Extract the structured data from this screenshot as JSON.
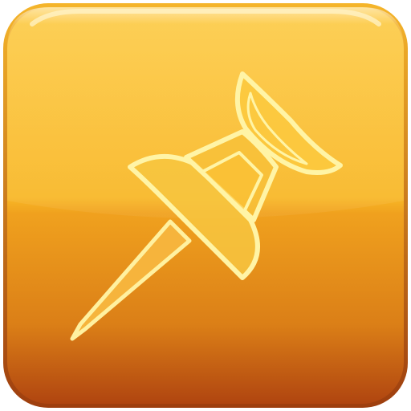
{
  "icon": {
    "name": "pushpin-icon",
    "colors": {
      "tile_top": "#FDC22F",
      "tile_mid": "#F1A01B",
      "tile_bottom": "#B14710",
      "border_outer": "#D9961C",
      "border_inner": "#FFE17A",
      "pin_fill": "#FFE05A",
      "pin_stroke": "#FFF6A8"
    }
  }
}
